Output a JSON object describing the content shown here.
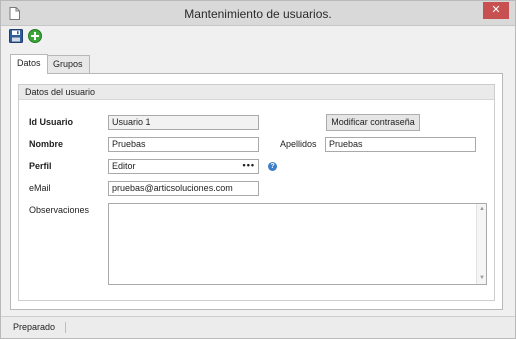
{
  "window": {
    "title": "Mantenimiento de usuarios.",
    "close_symbol": "✕"
  },
  "toolbar": {
    "save_icon": "floppy-disk-icon",
    "add_icon": "add-circle-icon"
  },
  "tabs": [
    {
      "label": "Datos",
      "active": true
    },
    {
      "label": "Grupos",
      "active": false
    }
  ],
  "group": {
    "title": "Datos del usuario"
  },
  "form": {
    "id_label": "Id Usuario",
    "id_value": "Usuario 1",
    "change_password_label": "Modificar contraseña",
    "nombre_label": "Nombre",
    "nombre_value": "Pruebas",
    "apellidos_label": "Apellidos",
    "apellidos_value": "Pruebas",
    "perfil_label": "Perfil",
    "perfil_value": "Editor",
    "perfil_button": "•••",
    "help_symbol": "?",
    "email_label": "eMail",
    "email_value": "pruebas@articsoluciones.com",
    "observaciones_label": "Observaciones",
    "observaciones_value": ""
  },
  "status": {
    "text": "Preparado"
  },
  "colors": {
    "close_button": "#c75050",
    "help_icon": "#3e7ec7",
    "add_icon": "#3aa63a",
    "save_icon": "#2f5d9a"
  }
}
